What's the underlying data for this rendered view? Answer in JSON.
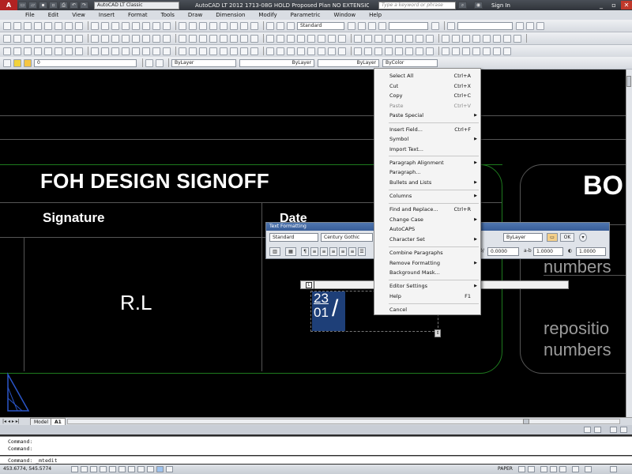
{
  "titlebar": {
    "workspace": "AutoCAD LT Classic",
    "title": "AutoCAD LT 2012    1713-08G HOLD Proposed Plan NO EXTENSION.dwg",
    "search_placeholder": "Type a keyword or phrase",
    "signin": "Sign In"
  },
  "menubar": {
    "items": [
      "File",
      "Edit",
      "View",
      "Insert",
      "Format",
      "Tools",
      "Draw",
      "Dimension",
      "Modify",
      "Parametric",
      "Window",
      "Help"
    ]
  },
  "toolbar": {
    "text_style": "Standard",
    "layer": "0",
    "color": "ByLayer",
    "linetype": "ByLayer",
    "lineweight": "ByLayer",
    "plotstyle": "ByColor"
  },
  "drawing": {
    "foh_title": "FOH DESIGN SIGNOFF",
    "signature_label": "Signature",
    "date_label": "Date",
    "initials": "R.L",
    "bo_text": "BO",
    "right_note1": "numbers",
    "right_note2_line1": "repositio",
    "right_note2_line2": "numbers",
    "date_line1": "23",
    "date_line2": "01"
  },
  "text_formatting": {
    "title": "Text Formatting",
    "style": "Standard",
    "font": "Century Gothic",
    "color": "ByLayer",
    "ok": "OK",
    "oblique": "0.0000",
    "tracking": "1.0000",
    "width": "1.0000"
  },
  "context_menu": {
    "groups": [
      [
        {
          "label": "Select All",
          "shortcut": "Ctrl+A"
        },
        {
          "label": "Cut",
          "shortcut": "Ctrl+X"
        },
        {
          "label": "Copy",
          "shortcut": "Ctrl+C"
        },
        {
          "label": "Paste",
          "shortcut": "Ctrl+V",
          "disabled": true
        },
        {
          "label": "Paste Special",
          "submenu": true
        }
      ],
      [
        {
          "label": "Insert Field...",
          "shortcut": "Ctrl+F"
        },
        {
          "label": "Symbol",
          "submenu": true
        },
        {
          "label": "Import Text..."
        }
      ],
      [
        {
          "label": "Paragraph Alignment",
          "submenu": true
        },
        {
          "label": "Paragraph..."
        },
        {
          "label": "Bullets and Lists",
          "submenu": true
        }
      ],
      [
        {
          "label": "Columns",
          "submenu": true
        }
      ],
      [
        {
          "label": "Find and Replace...",
          "shortcut": "Ctrl+R"
        },
        {
          "label": "Change Case",
          "submenu": true
        },
        {
          "label": "AutoCAPS"
        },
        {
          "label": "Character Set",
          "submenu": true
        }
      ],
      [
        {
          "label": "Combine Paragraphs"
        },
        {
          "label": "Remove Formatting",
          "submenu": true
        },
        {
          "label": "Background Mask..."
        }
      ],
      [
        {
          "label": "Editor Settings",
          "submenu": true
        },
        {
          "label": "Help",
          "shortcut": "F1"
        }
      ],
      [
        {
          "label": "Cancel"
        }
      ]
    ]
  },
  "layout_tabs": {
    "model": "Model",
    "layout": "A1"
  },
  "command": {
    "history1": "Command:",
    "history2": "Command:",
    "current": "Command:  _mtedit"
  },
  "statusbar": {
    "coordinates": "453.6774, 545.5774",
    "space": "PAPER"
  }
}
